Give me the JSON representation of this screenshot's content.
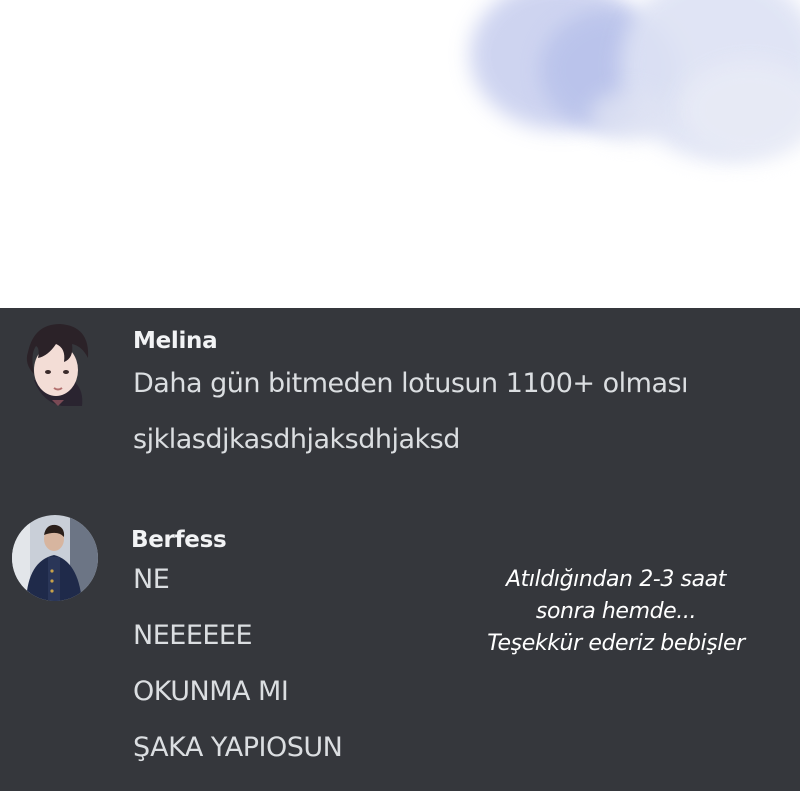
{
  "messages": [
    {
      "username": "Melina",
      "lines": [
        "Daha gün bitmeden lotusun 1100+ olması",
        "sjklasdjkasdhjaksdhjaksd"
      ]
    },
    {
      "username": "Berfess",
      "lines": [
        "NE",
        "NEEEEEE",
        "OKUNMA MI",
        "ŞAKA YAPIOSUN"
      ]
    }
  ],
  "note": {
    "lines": [
      "Atıldığından 2-3 saat",
      "sonra hemde...",
      "Teşekkür ederiz bebişler"
    ]
  },
  "colors": {
    "chat_background": "#35373c",
    "username": "#f2f3f5",
    "message_text": "#dbdee1",
    "note_text": "#ffffff",
    "sky_background": "#ffffff",
    "cloud": "#b9c3e6"
  },
  "avatars": [
    {
      "owner": "Melina",
      "description_icon": "anime-character-avatar-icon"
    },
    {
      "owner": "Berfess",
      "description_icon": "uniformed-man-avatar-icon"
    }
  ]
}
